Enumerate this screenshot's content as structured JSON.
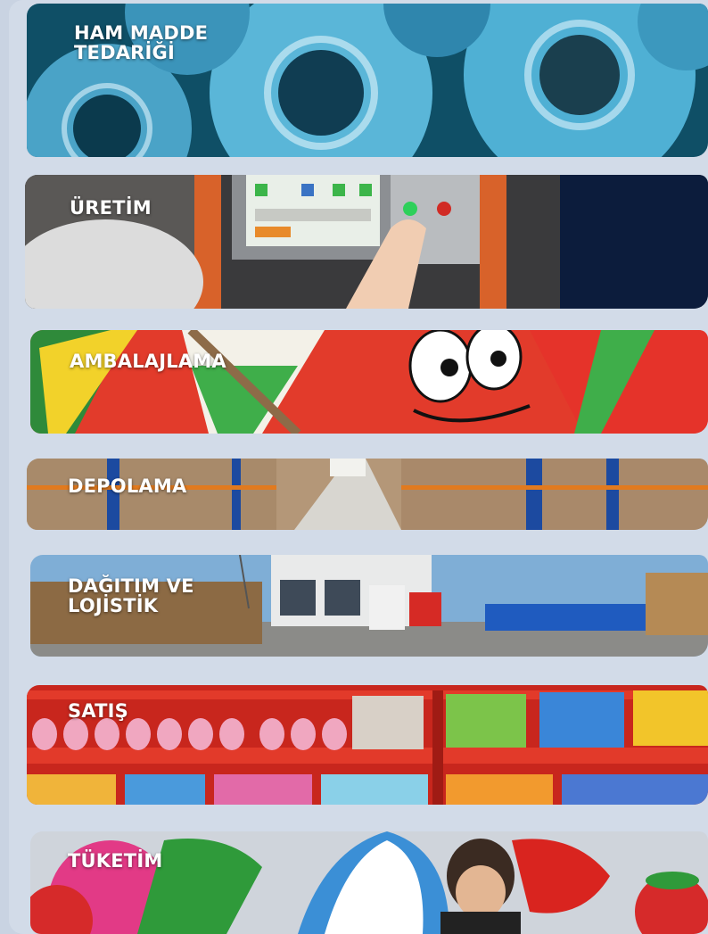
{
  "steps": [
    {
      "id": "ham-madde",
      "label": "HAM MADDE\nTEDARİĞİ",
      "theme": "blue-gummy-rings"
    },
    {
      "id": "uretim",
      "label": "ÜRETİM",
      "theme": "control-panel"
    },
    {
      "id": "ambalajlama",
      "label": "AMBALAJLAMA",
      "theme": "watermelon-packaging"
    },
    {
      "id": "depolama",
      "label": "DEPOLAMA",
      "theme": "warehouse"
    },
    {
      "id": "dagitim",
      "label": "DAĞITIM VE\nLOJİSTİK",
      "theme": "trucks-loading-dock"
    },
    {
      "id": "satis",
      "label": "SATIŞ",
      "theme": "store-shelves"
    },
    {
      "id": "tuketim",
      "label": "TÜKETİM",
      "theme": "child-balloons"
    }
  ],
  "colors": {
    "page_bg": "#d2dbe8",
    "label": "#ffffff"
  }
}
